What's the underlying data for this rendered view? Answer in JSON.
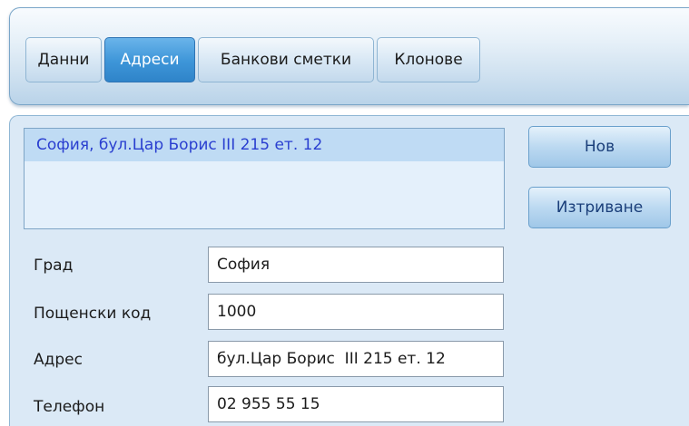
{
  "tabs": [
    {
      "label": "Данни",
      "active": false
    },
    {
      "label": "Адреси",
      "active": true
    },
    {
      "label": "Банкови сметки",
      "active": false
    },
    {
      "label": "Клонове",
      "active": false
    }
  ],
  "address_list": {
    "items": [
      "София, бул.Цар Борис  III 215 ет. 12"
    ]
  },
  "actions": {
    "new_label": "Нов",
    "delete_label": "Изтриване"
  },
  "form": {
    "city": {
      "label": "Град",
      "value": "София"
    },
    "postal_code": {
      "label": "Пощенски код",
      "value": "1000"
    },
    "address": {
      "label": "Адрес",
      "value": "бул.Цар Борис  III 215 ет. 12"
    },
    "phone": {
      "label": "Телефон",
      "value": "02 955 55 15"
    }
  },
  "colors": {
    "active_tab": "#3d95d8",
    "selected_item_bg": "#bfdbf4",
    "selected_item_text": "#2a3fd0",
    "panel_bg": "#dbe9f6"
  }
}
